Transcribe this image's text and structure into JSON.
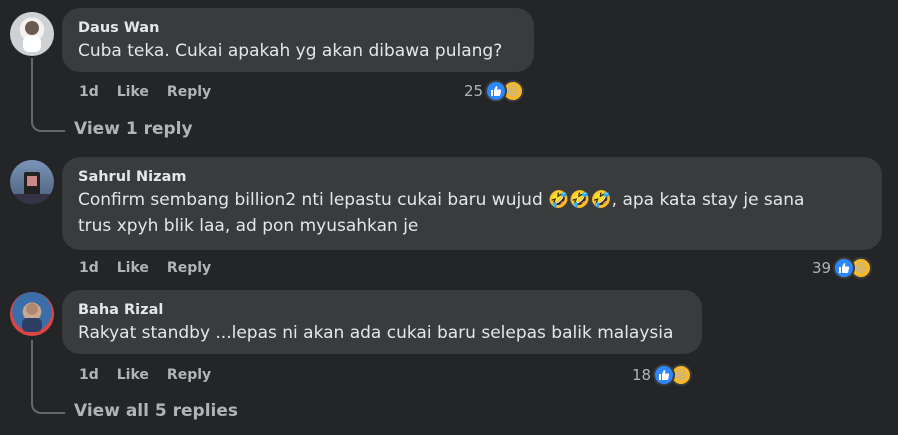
{
  "comments": [
    {
      "author": "Daus Wan",
      "text": "Cuba teka. Cukai apakah yg akan dibawa pulang?",
      "time": "1d",
      "like_label": "Like",
      "reply_label": "Reply",
      "reaction_count": "25",
      "view_replies": "View 1 reply"
    },
    {
      "author": "Sahrul Nizam",
      "text_line1": "Confirm sembang billion2 nti lepastu cukai baru wujud 🤣🤣🤣, apa kata stay je sana",
      "text_line2": "trus xpyh blik laa, ad pon myusahkan je",
      "time": "1d",
      "like_label": "Like",
      "reply_label": "Reply",
      "reaction_count": "39"
    },
    {
      "author": "Baha Rizal",
      "text": "Rakyat standby ...lepas ni akan ada cukai baru selepas balik malaysia",
      "time": "1d",
      "like_label": "Like",
      "reply_label": "Reply",
      "reaction_count": "18",
      "view_replies": "View all 5 replies"
    }
  ],
  "colors": {
    "background": "#242526",
    "bubble": "#3a3b3c",
    "like": "#2d88ff",
    "haha": "#f7b928"
  }
}
